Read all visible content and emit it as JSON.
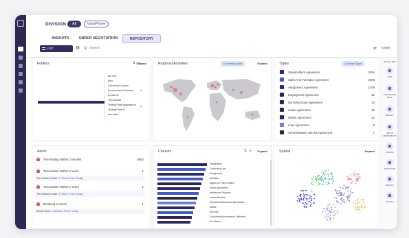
{
  "header": {
    "division_label": "DIVISION",
    "division_all": "All",
    "division_vp": "VoicePhone",
    "tabs": [
      {
        "label": "INSIGHTS"
      },
      {
        "label": "UNDER NEGOTIATION"
      },
      {
        "label": "REPOSITORY"
      }
    ]
  },
  "toolbar": {
    "list_button": "LIST DOCUMENTS",
    "search_placeholder": "Search",
    "count": "5,846"
  },
  "folders": {
    "title": "Folders",
    "expand": "Expand",
    "items": [
      "AB Test",
      "Alex",
      "Cloudward Upload",
      "Procurement Contracts",
      "Runtis GL",
      "Test Upload",
      "TestingFolderAppearance",
      "TestingFolder/2",
      "term data"
    ]
  },
  "regional": {
    "title": "Regional Activities",
    "filter": "Governing Law",
    "expand": "Expand"
  },
  "types": {
    "title": "Types",
    "filter": "Contract Type",
    "rows": [
      {
        "name": "Shareholders Agreement",
        "value": "2354",
        "color": "#2f2a66"
      },
      {
        "name": "Sales And Purchase Agreement",
        "value": "2088",
        "color": "#3d5bd8"
      },
      {
        "name": "Assignment Agreement",
        "value": "1209",
        "color": "#2f2a66"
      },
      {
        "name": "Employment Agreement",
        "value": "61",
        "color": "#2a2850"
      },
      {
        "name": "Non-Disclosure Agreement",
        "value": "33",
        "color": "#2a2850"
      },
      {
        "name": "Lease Agreement",
        "value": "25",
        "color": "#2a2850"
      },
      {
        "name": "Option Agreement",
        "value": "22",
        "color": "#2a2850"
      },
      {
        "name": "Loan Agreement",
        "value": "8",
        "color": "#6f7fdc"
      },
      {
        "name": "Service/Master Service Agreement",
        "value": "7",
        "color": "#2a2850"
      }
    ]
  },
  "alerts": {
    "title": "Alerts",
    "rows": [
      {
        "label": "Terminating Within 2 Months",
        "value": "5862"
      },
      {
        "label": "Termination Within 2 Years",
        "value": "1"
      },
      {
        "label": "Termination Within 2 Years",
        "value": "1"
      },
      {
        "label": "Breaking In 6mos",
        "value": "1"
      }
    ],
    "subs": [
      {
        "label": "Termination Date:",
        "link": "2 Years From Today"
      },
      {
        "label": "Termination Date:",
        "link": "2 Years From Today"
      },
      {
        "label": "Break Date:",
        "link": "2 Months From Today"
      }
    ]
  },
  "clauses": {
    "title": "Clauses",
    "expand": "Expand",
    "items": [
      "Termination",
      "Governing Law",
      "Assignment",
      "Variation",
      "Rights Of Third Parties",
      "Entire Agreement",
      "Intellectual Property",
      "Indemnification",
      "Representations And Warranties",
      "Notice",
      "Survival",
      "Confidential Information Definition",
      "No Waiver"
    ]
  },
  "spatial": {
    "title": "Spatial",
    "expand": "Expand"
  },
  "sidebar_right": {
    "items": [
      {
        "label": "ATTACH BAR"
      },
      {
        "label": "TASK"
      },
      {
        "label": "KNOWLEDGE BANK"
      },
      {
        "label": "REDACT"
      },
      {
        "label": "ADD IN AMENDMENTS"
      },
      {
        "label": "UPDATE"
      },
      {
        "label": "DOWNLOAD"
      },
      {
        "label": "REPORT"
      },
      {
        "label": "DELETE"
      }
    ]
  },
  "colors": {
    "accent": "#2f2d5e",
    "link": "#3a5bd9",
    "alert": "#e25353"
  }
}
